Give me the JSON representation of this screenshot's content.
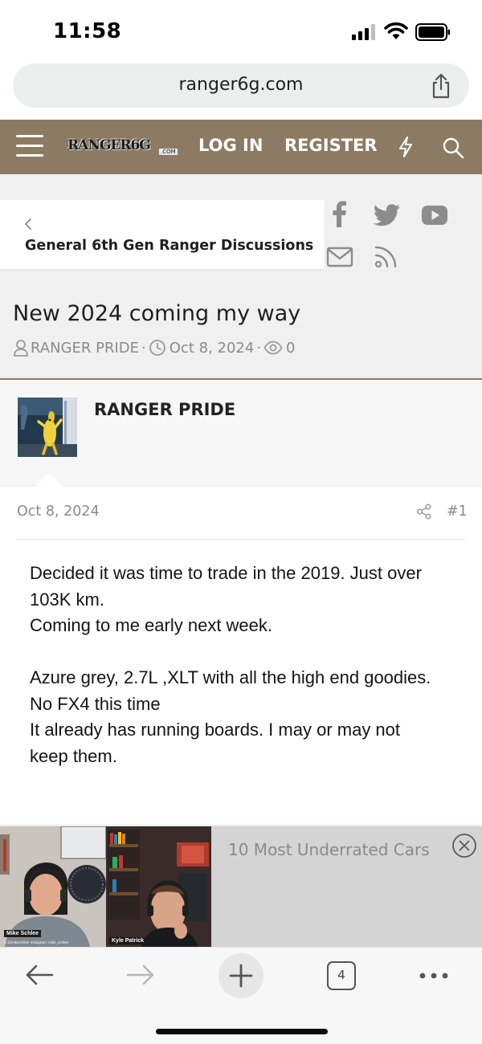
{
  "status_bar": {
    "time": "11:58"
  },
  "browser": {
    "url": "ranger6g.com"
  },
  "site_header": {
    "logo_text": "RANGER6G",
    "logo_suffix": ".COM",
    "login_label": "LOG IN",
    "register_label": "REGISTER",
    "header_color": "#8c7a63"
  },
  "breadcrumb": {
    "label": "General 6th Gen Ranger Discussions"
  },
  "social_icons": [
    "facebook-icon",
    "twitter-icon",
    "youtube-icon",
    "email-icon",
    "rss-icon"
  ],
  "thread": {
    "title": "New 2024 coming my way",
    "author": "RANGER PRIDE",
    "date": "Oct 8, 2024",
    "views": "0"
  },
  "post": {
    "username": "RANGER PRIDE",
    "date": "Oct 8, 2024",
    "number": "#1",
    "body_lines": [
      "Decided it was time to trade in the 2019. Just over",
      "103K km.",
      "Coming to me early next week.",
      "",
      "Azure grey, 2.7L ,XLT with all the high end goodies.",
      "No FX4 this time",
      "It already has running boards. I may or may not",
      "keep them."
    ]
  },
  "ad": {
    "title": "10 Most Underrated Cars",
    "speakers": [
      {
        "name": "Mike Schlee",
        "caption": "X @mikeschlee Instagram: mike_schlee"
      },
      {
        "name": "Kyle Patrick"
      }
    ]
  },
  "toolbar": {
    "tab_count": "4"
  }
}
